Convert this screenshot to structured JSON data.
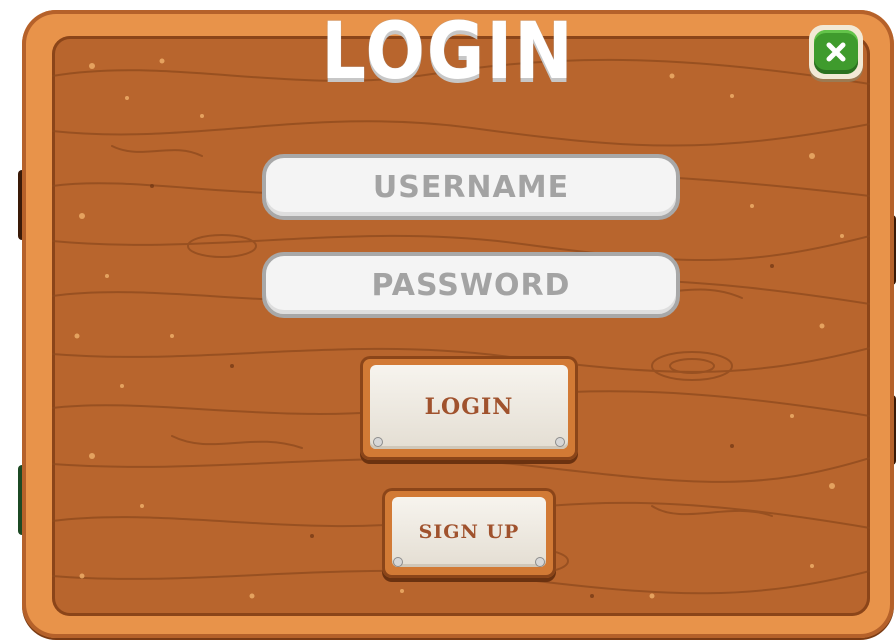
{
  "dialog": {
    "title": "LOGIN"
  },
  "form": {
    "username_placeholder": "USERNAME",
    "password_placeholder": "PASSWORD",
    "login_label": "LOGIN",
    "signup_label": "SIGN UP"
  },
  "icons": {
    "close": "close-x-icon"
  },
  "colors": {
    "board_outer": "#e8934a",
    "board_inner": "#b8652d",
    "close_green": "#3f9b2d",
    "button_text": "#a0522d",
    "field_text": "#9c9c9c"
  }
}
